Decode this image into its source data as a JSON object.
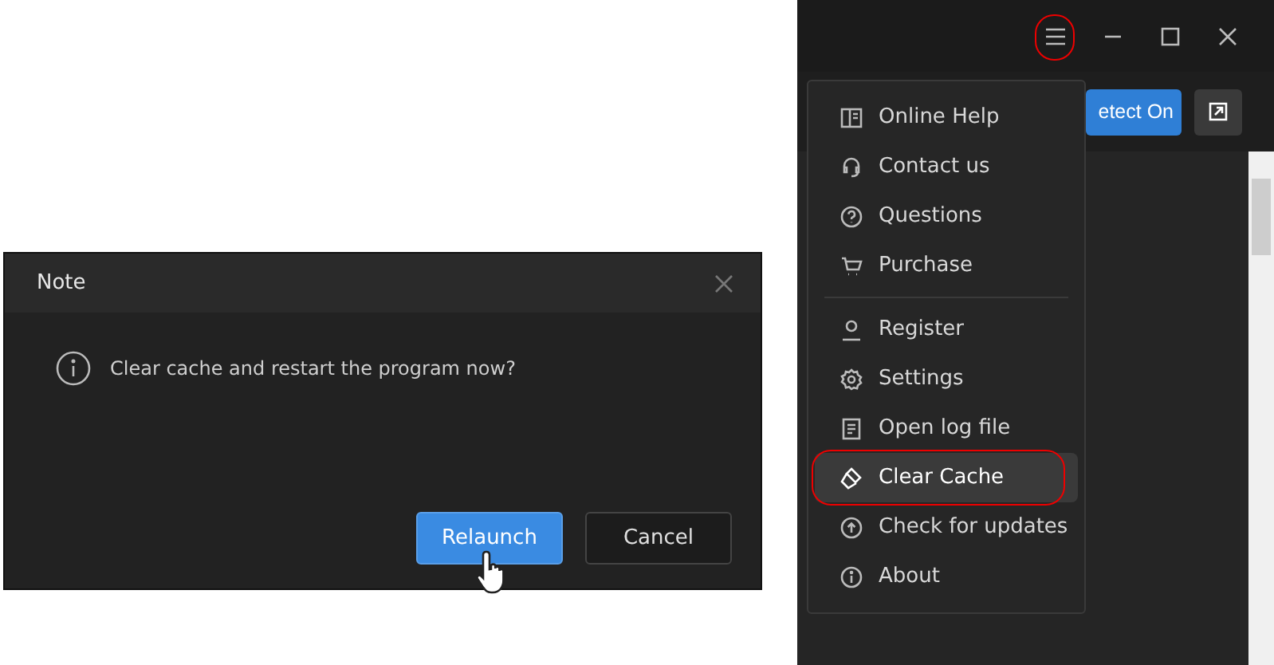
{
  "dialog": {
    "title": "Note",
    "message": "Clear cache and restart the program now?",
    "buttons": [
      {
        "label": "Relaunch",
        "kind": "primary",
        "hovered": true
      },
      {
        "label": "Cancel",
        "kind": "secondary",
        "hovered": false
      }
    ]
  },
  "app_window": {
    "menu_button": {
      "circled": true
    },
    "toolbar": {
      "detect_button": "etect On"
    },
    "menu": {
      "sections": [
        [
          {
            "label": "Online Help",
            "selected": false,
            "circled": false
          },
          {
            "label": "Contact us",
            "selected": false,
            "circled": false
          },
          {
            "label": "Questions",
            "selected": false,
            "circled": false
          },
          {
            "label": "Purchase",
            "selected": false,
            "circled": false
          }
        ],
        [
          {
            "label": "Register",
            "selected": false,
            "circled": false
          },
          {
            "label": "Settings",
            "selected": false,
            "circled": false
          },
          {
            "label": "Open log file",
            "selected": false,
            "circled": false
          },
          {
            "label": "Clear Cache",
            "selected": true,
            "circled": true
          },
          {
            "label": "Check for updates",
            "selected": false,
            "circled": false
          },
          {
            "label": "About",
            "selected": false,
            "circled": false
          }
        ]
      ]
    }
  }
}
